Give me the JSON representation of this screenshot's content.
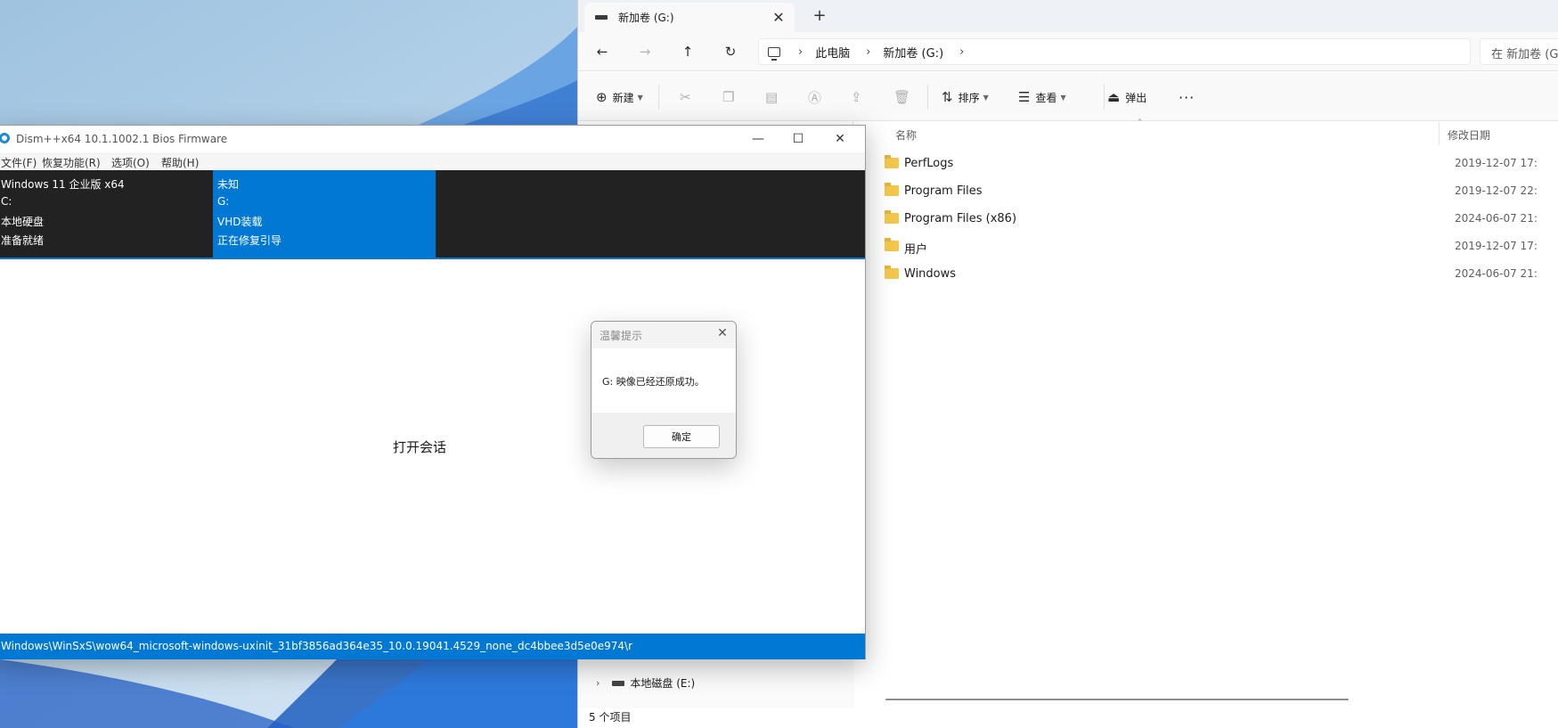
{
  "explorer": {
    "tab": {
      "label": "新加卷 (G:)",
      "close": "✕"
    },
    "new_tab": "+",
    "nav": {
      "back": "←",
      "forward": "→",
      "up": "↑",
      "refresh": "↻"
    },
    "breadcrumb": [
      "此电脑",
      "新加卷 (G:)"
    ],
    "breadcrumb_sep": "›",
    "search_placeholder": "在 新加卷 (G:",
    "toolbar": {
      "new_label": "新建",
      "sort_label": "排序",
      "view_label": "查看",
      "eject_label": "弹出",
      "more": "···"
    },
    "columns": {
      "name": "名称",
      "date": "修改日期"
    },
    "files": [
      {
        "name": "PerfLogs",
        "date": "2019-12-07 17:"
      },
      {
        "name": "Program Files",
        "date": "2019-12-07 22:"
      },
      {
        "name": "Program Files (x86)",
        "date": "2024-06-07 21:"
      },
      {
        "name": "用户",
        "date": "2019-12-07 17:"
      },
      {
        "name": "Windows",
        "date": "2024-06-07 21:"
      }
    ],
    "nav_pane": {
      "drive_label": "本地磁盘 (E:)"
    },
    "status": "5 个项目"
  },
  "dism": {
    "title": "Dism++x64 10.1.1002.1 Bios Firmware",
    "window_controls": {
      "minimize": "—",
      "maximize": "☐",
      "close": "✕"
    },
    "menu": [
      "文件(F)",
      "恢复功能(R)",
      "选项(O)",
      "帮助(H)"
    ],
    "sessions": [
      {
        "lines": [
          "Windows 11 企业版 x64",
          "C:",
          "本地硬盘",
          "准备就绪"
        ]
      },
      {
        "lines": [
          "未知",
          "G:",
          "VHD装载",
          "正在修复引导"
        ]
      }
    ],
    "open_session": "打开会话",
    "status": "Windows\\WinSxS\\wow64_microsoft-windows-uxinit_31bf3856ad364e35_10.0.19041.4529_none_dc4bbee3d5e0e974\\r"
  },
  "dialog": {
    "title": "温馨提示",
    "close": "✕",
    "message": "G: 映像已经还原成功。",
    "ok_label": "确定"
  },
  "colors": {
    "accent": "#0078d4",
    "session_bg": "#222222",
    "folder": "#f3c64a"
  }
}
